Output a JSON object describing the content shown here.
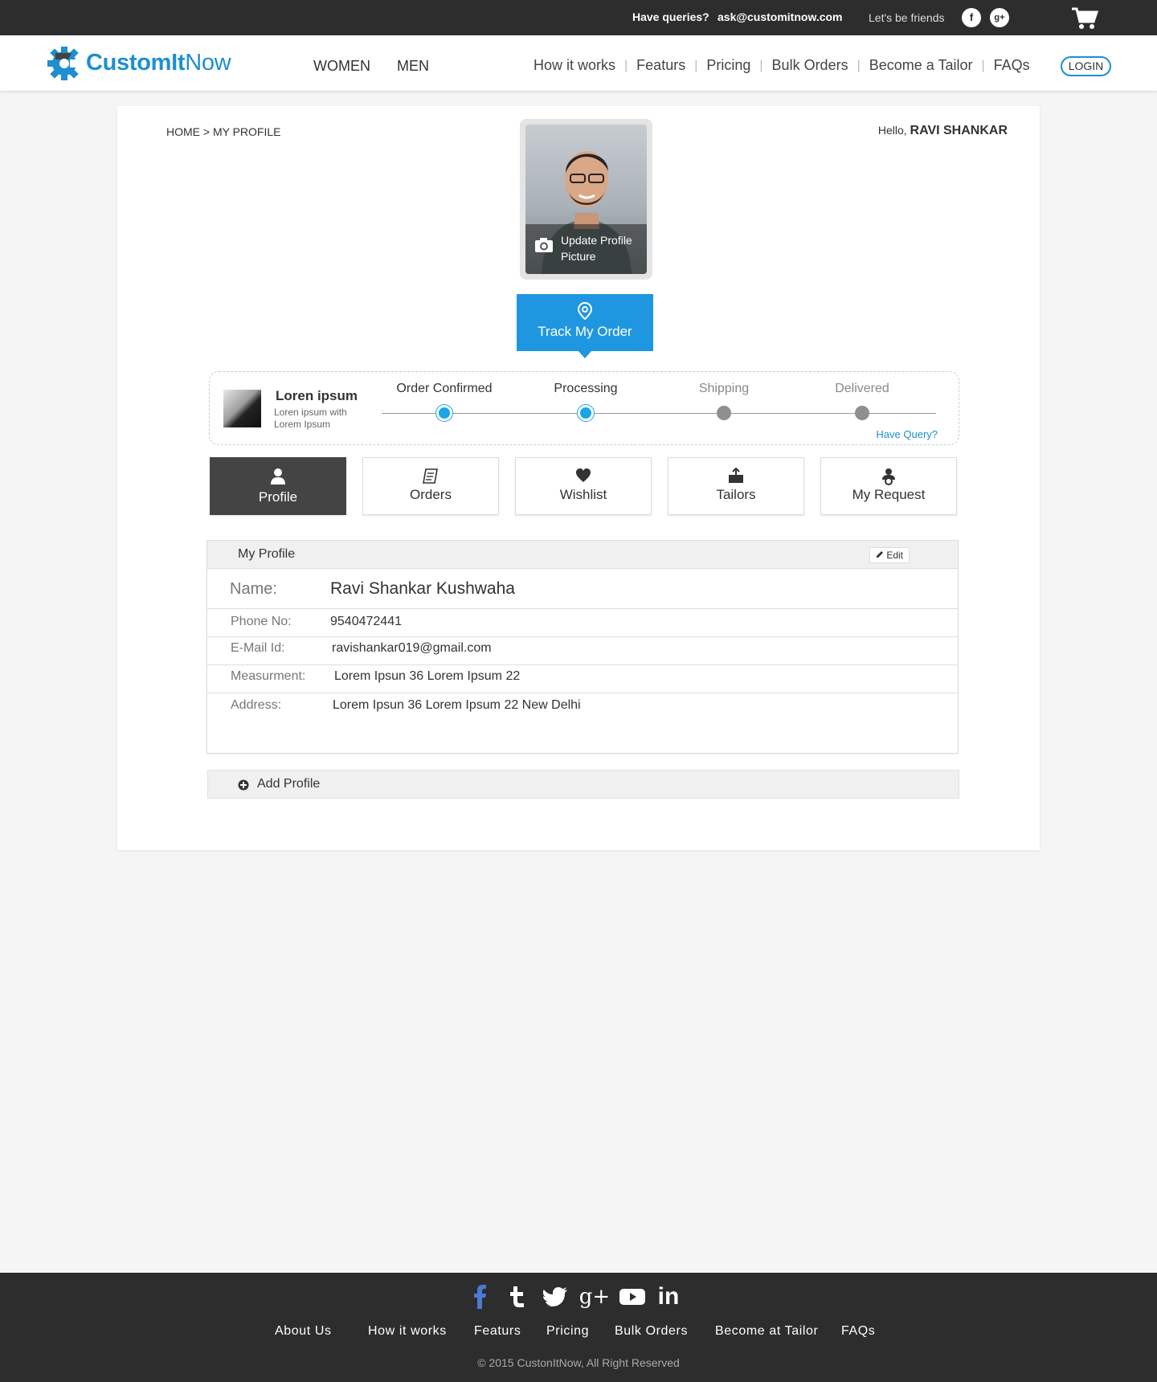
{
  "topbar": {
    "queries_label": "Have queries?",
    "email": "ask@customitnow.com",
    "friends_label": "Let's be friends",
    "social": [
      "f",
      "g+"
    ]
  },
  "header": {
    "logo_part1": "CustomIt",
    "logo_part2": "Now",
    "nav_gender": [
      "WOMEN",
      "MEN"
    ],
    "nav_links": [
      "How it works",
      "Featurs",
      "Pricing",
      "Bulk Orders",
      "Become a Tailor",
      "FAQs"
    ],
    "login_label": "LOGIN"
  },
  "page": {
    "breadcrumb": "HOME > MY PROFILE",
    "hello_prefix": "Hello,",
    "hello_name": "RAVI SHANKAR",
    "update_picture_label": "Update Profile Picture",
    "update_picture_line1": "Update Profile",
    "update_picture_line2": "Picture",
    "track_order_label": "Track My Order"
  },
  "order": {
    "name": "Loren ipsum",
    "sub": "Loren ipsum with Lorem Ipsum",
    "steps": [
      {
        "label": "Order Confirmed",
        "done": true
      },
      {
        "label": "Processing",
        "done": true
      },
      {
        "label": "Shipping",
        "done": false
      },
      {
        "label": "Delivered",
        "done": false
      }
    ],
    "have_query": "Have Query?"
  },
  "tabs": [
    {
      "label": "Profile",
      "icon": "user-icon",
      "active": true
    },
    {
      "label": "Orders",
      "icon": "receipt-icon",
      "active": false
    },
    {
      "label": "Wishlist",
      "icon": "heart-icon",
      "active": false
    },
    {
      "label": "Tailors",
      "icon": "tailor-icon",
      "active": false
    },
    {
      "label": "My Request",
      "icon": "request-icon",
      "active": false
    }
  ],
  "profile": {
    "title": "My Profile",
    "edit_label": "Edit",
    "fields": {
      "name_key": "Name:",
      "name_val": "Ravi Shankar Kushwaha",
      "phone_key": "Phone No:",
      "phone_val": "9540472441",
      "email_key": "E-Mail Id:",
      "email_val": "ravishankar019@gmail.com",
      "measure_key": "Measurment:",
      "measure_val": "Lorem Ipsun 36 Lorem Ipsum 22",
      "address_key": "Address:",
      "address_val": "Lorem Ipsun 36 Lorem Ipsum 22 New Delhi"
    },
    "add_profile_label": "Add Profile"
  },
  "footer": {
    "social_icons": [
      "facebook-icon",
      "tumblr-icon",
      "twitter-icon",
      "google-plus-icon",
      "youtube-icon",
      "linkedin-icon"
    ],
    "links": [
      "About Us",
      "How it works",
      "Featurs",
      "Pricing",
      "Bulk Orders",
      "Become at Tailor",
      "FAQs"
    ],
    "copyright": "© 2015 CustonItNow, All Right Reserved"
  },
  "colors": {
    "accent": "#1e8fcf",
    "track_button": "#1f97e0",
    "step_done": "#1aa5e8",
    "dark_bar": "#2d2d2d",
    "active_tab": "#444444"
  }
}
